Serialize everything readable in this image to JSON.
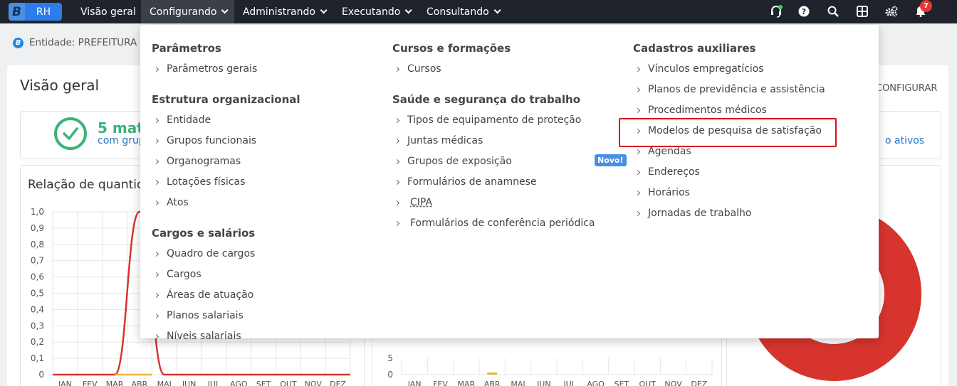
{
  "navbar": {
    "logo_b": "B",
    "logo_rh": "RH",
    "items": [
      "Visão geral",
      "Configurando",
      "Administrando",
      "Executando",
      "Consultando"
    ],
    "notification_count": "7"
  },
  "entity": {
    "label": "Entidade: PREFEITURA D"
  },
  "main": {
    "title": "Visão geral",
    "config_label": "CONFIGURAR",
    "summary_count": "5 matr",
    "summary_sub": "com grup",
    "summary_right": "o ativos",
    "chart_title": "Relação de quantid"
  },
  "menu": {
    "col1": {
      "sections": [
        {
          "title": "Parâmetros",
          "items": [
            "Parâmetros gerais"
          ]
        },
        {
          "title": "Estrutura organizacional",
          "items": [
            "Entidade",
            "Grupos funcionais",
            "Organogramas",
            "Lotações físicas",
            "Atos"
          ]
        },
        {
          "title": "Cargos e salários",
          "items": [
            "Quadro de cargos",
            "Cargos",
            "Áreas de atuação",
            "Planos salariais",
            "Níveis salariais"
          ]
        }
      ]
    },
    "col2": {
      "sections": [
        {
          "title": "Cursos e formações",
          "items": [
            "Cursos"
          ]
        },
        {
          "title": "Saúde e segurança do trabalho",
          "items": [
            "Tipos de equipamento de proteção",
            "Juntas médicas",
            "Grupos de exposição",
            "Formulários de anamnese",
            "CIPA",
            "Formulários de conferência periódica"
          ]
        }
      ],
      "new_badge": "Novo!"
    },
    "col3": {
      "sections": [
        {
          "title": "Cadastros auxiliares",
          "items": [
            "Vínculos empregatícios",
            "Planos de previdência e assistência",
            "Procedimentos médicos",
            "Modelos de pesquisa de satisfação",
            "Agendas",
            "Endereços",
            "Horários",
            "Jornadas de trabalho"
          ]
        }
      ]
    }
  },
  "chart_data": [
    {
      "type": "line",
      "title": "Relação de quantid",
      "categories": [
        "JAN",
        "FEV",
        "MAR",
        "ABR",
        "MAI",
        "JUN",
        "JUL",
        "AGO",
        "SET",
        "OUT",
        "NOV",
        "DEZ"
      ],
      "yticks": [
        "0",
        "0,1",
        "0,2",
        "0,3",
        "0,4",
        "0,5",
        "0,6",
        "0,7",
        "0,8",
        "0,9",
        "1,0"
      ],
      "ylim": [
        0,
        1
      ],
      "series": [
        {
          "values": [
            0,
            0,
            0,
            1,
            0,
            0,
            0,
            0,
            0,
            0,
            0,
            0
          ],
          "color": "#d7342e"
        }
      ]
    },
    {
      "type": "bar",
      "categories": [
        "JAN",
        "FEV",
        "MAR",
        "ABR",
        "MAI",
        "JUN",
        "JUL",
        "AGO",
        "SET",
        "OUT",
        "NOV",
        "DEZ"
      ],
      "yticks": [
        "0",
        "5"
      ],
      "series": [
        {
          "values": [
            0,
            0,
            0,
            0.2,
            0,
            0,
            0,
            0,
            0,
            0,
            0,
            0
          ],
          "color": "#e8b739"
        }
      ]
    },
    {
      "type": "pie",
      "series": [
        {
          "values": [
            1
          ],
          "color": "#d7342e"
        }
      ]
    }
  ]
}
